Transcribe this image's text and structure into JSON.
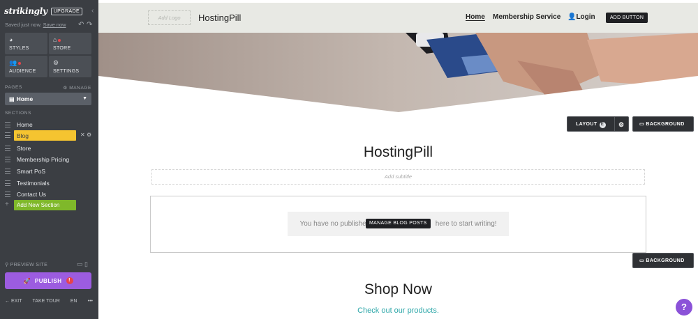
{
  "sidebar": {
    "logo": "strikingly",
    "upgrade": "UPGRADE",
    "saved_prefix": "Saved just now.",
    "saved_link": "Save now",
    "tiles": [
      {
        "label": "STYLES",
        "icon": "palette-icon"
      },
      {
        "label": "STORE",
        "icon": "store-icon"
      },
      {
        "label": "AUDIENCE",
        "icon": "audience-icon"
      },
      {
        "label": "SETTINGS",
        "icon": "gear-icon"
      }
    ],
    "pages_heading": "PAGES",
    "manage": "MANAGE",
    "current_page": "Home",
    "sections_heading": "SECTIONS",
    "sections": [
      "Home",
      "Blog",
      "Store",
      "Membership Pricing",
      "Smart PoS",
      "Testimonials",
      "Contact Us"
    ],
    "active_section": "Blog",
    "add_section": "Add New Section",
    "preview_site": "PREVIEW SITE",
    "publish": "PUBLISH",
    "publish_badge": "!",
    "exit": "EXIT",
    "take_tour": "TAKE TOUR",
    "language": "EN",
    "more": "•••"
  },
  "nav": {
    "add_logo": "Add Logo",
    "site_title": "HostingPill",
    "links": [
      "Home",
      "Membership Service",
      "Login"
    ],
    "add_button": "ADD BUTTON"
  },
  "section_controls": {
    "layout": "LAYOUT",
    "layout_badge": "E",
    "background": "BACKGROUND"
  },
  "blog": {
    "title": "HostingPill",
    "subtitle_placeholder": "Add subtitle",
    "empty_before": "You have no publishe",
    "empty_after": " here to start writing!",
    "manage_posts": "MANAGE BLOG POSTS"
  },
  "shop": {
    "title": "Shop Now",
    "subtitle": "Check out our products."
  },
  "help": "?",
  "colors": {
    "sidebar_bg": "#3b3e43",
    "active_section": "#f5c430",
    "add_section": "#7fb82a",
    "publish": "#9c5ce0",
    "accent_teal": "#2ba6a8",
    "help": "#8b52d8"
  }
}
